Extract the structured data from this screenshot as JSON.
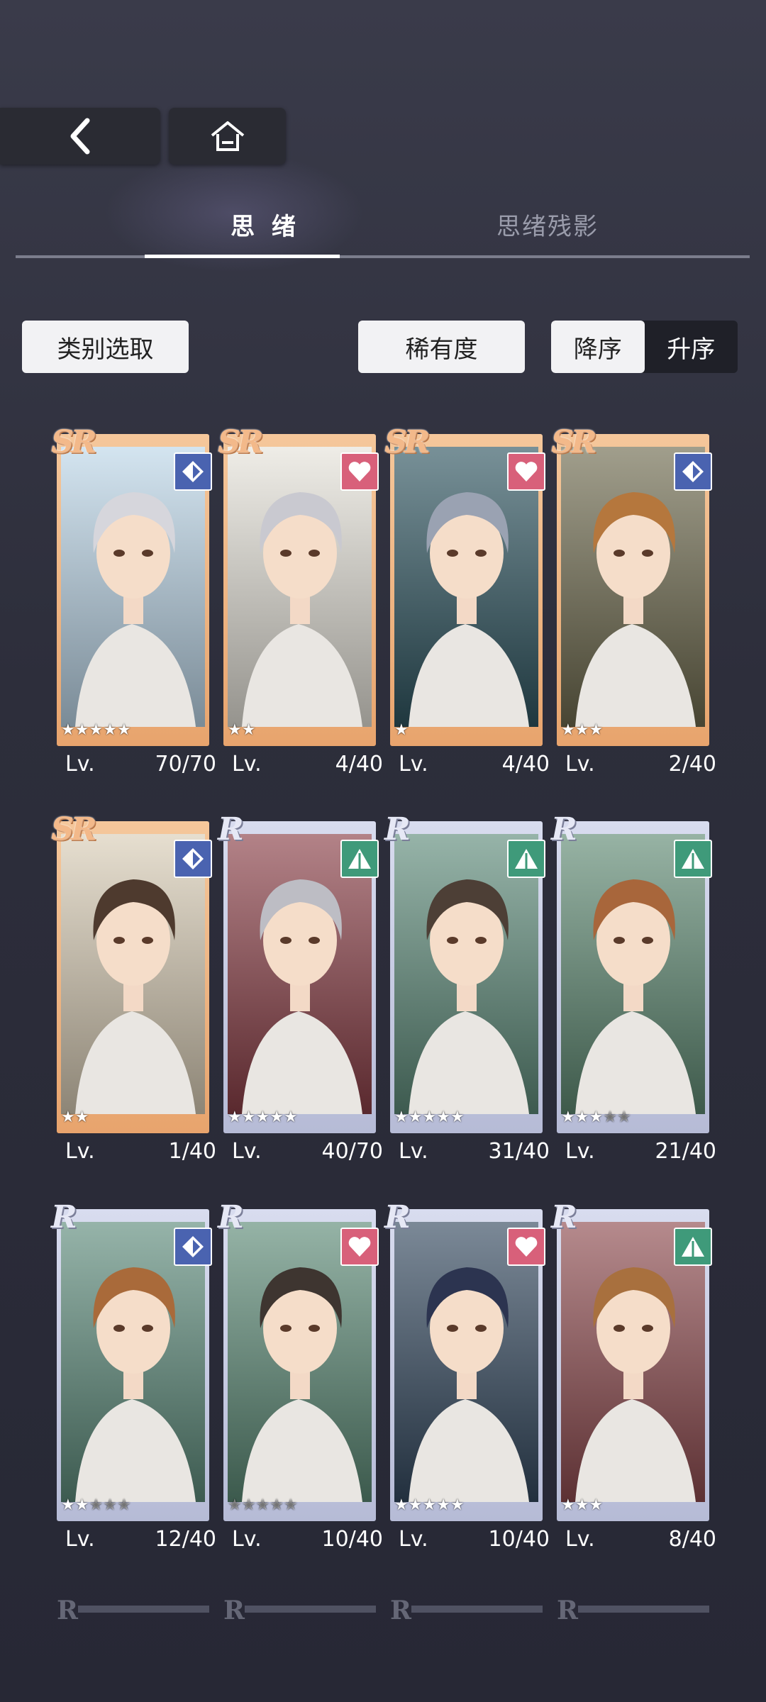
{
  "nav": {
    "back_icon": "chevron-left-icon",
    "home_icon": "home-icon"
  },
  "tabs": [
    {
      "label": "思 绪",
      "active": true
    },
    {
      "label": "思绪残影",
      "active": false
    }
  ],
  "filters": {
    "category_label": "类别选取",
    "rarity_label": "稀有度",
    "sort_desc_label": "降序",
    "sort_asc_label": "升序",
    "sort_selected": "降序"
  },
  "colors": {
    "sr_frame": "#e8a46d",
    "r_frame": "#c4c8e0",
    "type_blue": "#4a63b0",
    "type_pink": "#d8607a",
    "type_green": "#3f9a7a"
  },
  "cards": [
    {
      "rarity": "SR",
      "type": "blue-diamond-icon",
      "stars": 5,
      "stars_max": 5,
      "lv_label": "Lv.",
      "level": "70/70"
    },
    {
      "rarity": "SR",
      "type": "pink-heart-icon",
      "stars": 2,
      "stars_max": 2,
      "lv_label": "Lv.",
      "level": "4/40"
    },
    {
      "rarity": "SR",
      "type": "pink-heart-icon",
      "stars": 1,
      "stars_max": 1,
      "lv_label": "Lv.",
      "level": "4/40"
    },
    {
      "rarity": "SR",
      "type": "blue-diamond-icon",
      "stars": 3,
      "stars_max": 3,
      "lv_label": "Lv.",
      "level": "2/40"
    },
    {
      "rarity": "SR",
      "type": "blue-diamond-icon",
      "stars": 2,
      "stars_max": 2,
      "lv_label": "Lv.",
      "level": "1/40"
    },
    {
      "rarity": "R",
      "type": "green-triangle-icon",
      "stars": 5,
      "stars_max": 5,
      "lv_label": "Lv.",
      "level": "40/70"
    },
    {
      "rarity": "R",
      "type": "green-triangle-icon",
      "stars": 5,
      "stars_max": 5,
      "lv_label": "Lv.",
      "level": "31/40"
    },
    {
      "rarity": "R",
      "type": "green-triangle-icon",
      "stars": 3,
      "stars_max": 5,
      "lv_label": "Lv.",
      "level": "21/40"
    },
    {
      "rarity": "R",
      "type": "blue-diamond-icon",
      "stars": 2,
      "stars_max": 5,
      "lv_label": "Lv.",
      "level": "12/40"
    },
    {
      "rarity": "R",
      "type": "pink-heart-icon",
      "stars": 0,
      "stars_max": 5,
      "lv_label": "Lv.",
      "level": "10/40"
    },
    {
      "rarity": "R",
      "type": "pink-heart-icon",
      "stars": 5,
      "stars_max": 5,
      "lv_label": "Lv.",
      "level": "10/40"
    },
    {
      "rarity": "R",
      "type": "green-triangle-icon",
      "stars": 3,
      "stars_max": 3,
      "lv_label": "Lv.",
      "level": "8/40"
    }
  ],
  "partial_row_rarity": [
    "R",
    "R",
    "R",
    "R"
  ]
}
